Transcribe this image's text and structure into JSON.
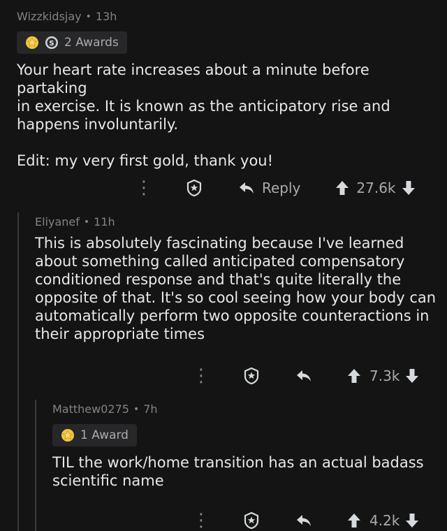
{
  "comments": [
    {
      "author": "Wizzkidsjay",
      "time": "13h",
      "awards_label": "2 Awards",
      "body_lines": [
        "Your heart rate increases about a minute before partaking",
        "in exercise. It is known as the anticipatory rise and",
        "happens involuntarily."
      ],
      "edit": "Edit: my very first gold, thank you!",
      "reply_label": "Reply",
      "score": "27.6k"
    },
    {
      "author": "Eliyanef",
      "time": "11h",
      "body_lines": [
        "This is absolutely fascinating because I've learned",
        "about something called anticipated compensatory",
        "conditioned response and that's quite literally the",
        "opposite of that. It's so cool seeing how your body can",
        "automatically perform two opposite counteractions in",
        "their appropriate times"
      ],
      "score": "7.3k"
    },
    {
      "author": "Matthew0275",
      "time": "7h",
      "awards_label": "1 Award",
      "body_lines": [
        "TIL the work/home transition has an actual badass",
        "scientific name"
      ],
      "score": "4.2k"
    }
  ],
  "separator": "•",
  "icons": {
    "more": "vertical-dots-icon",
    "award": "award-icon",
    "reply": "reply-arrow-icon",
    "upvote": "upvote-arrow-icon",
    "downvote": "downvote-arrow-icon",
    "gold": "gold-award-icon",
    "silver": "silver-award-icon"
  },
  "colors": {
    "background": "#141414",
    "text": "#e6e8ea",
    "meta": "#818384",
    "award_bg": "#272729",
    "gold": "#f5c542"
  }
}
